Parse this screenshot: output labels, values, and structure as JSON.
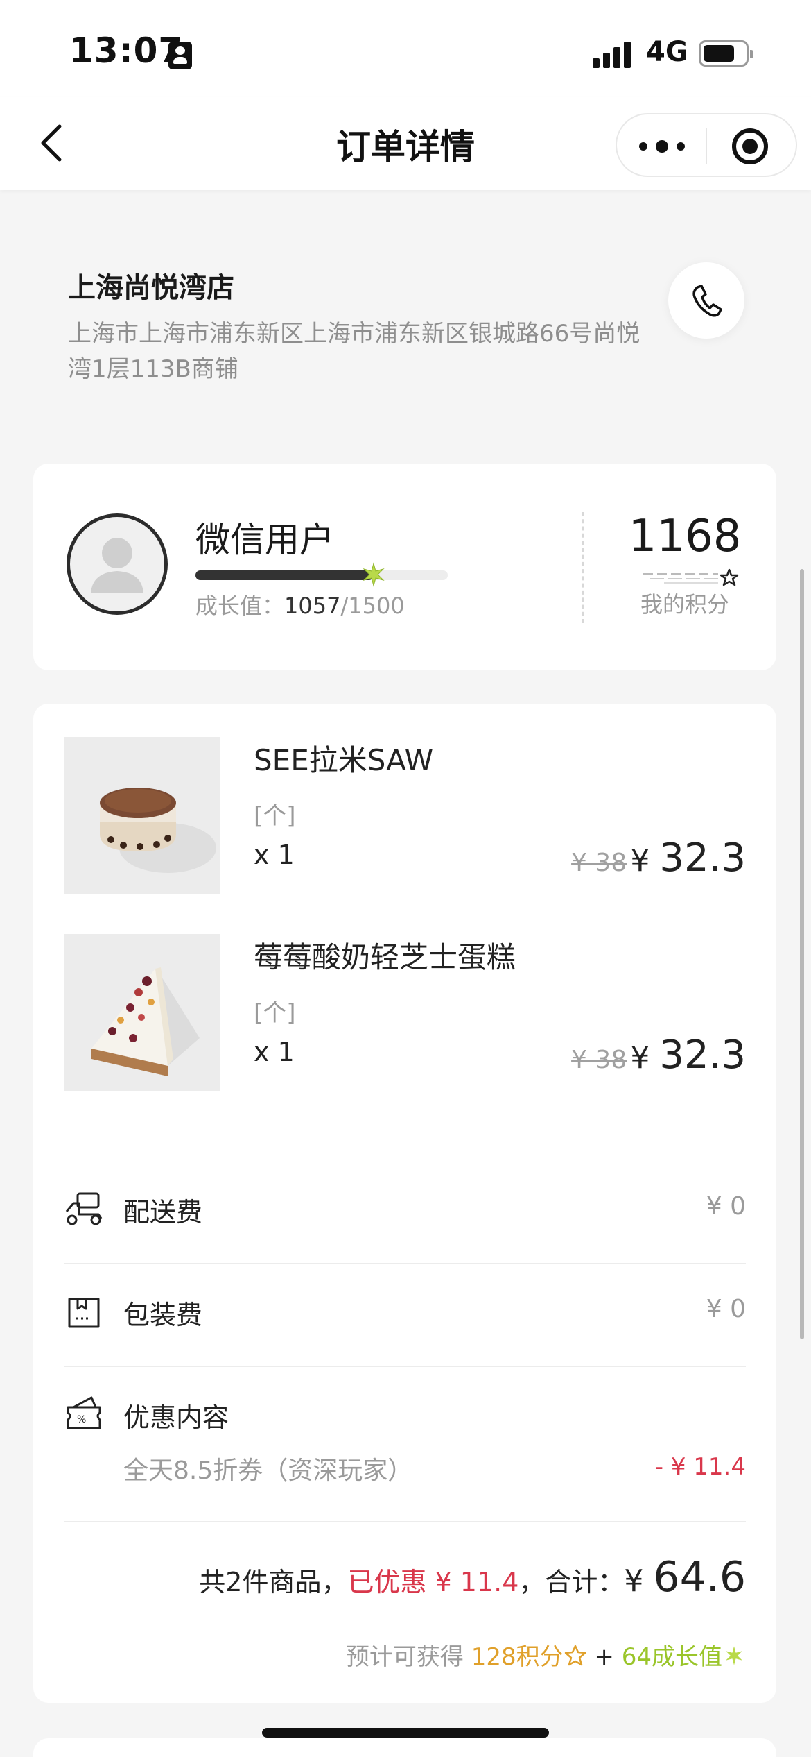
{
  "status_bar": {
    "time": "13:07",
    "network": "4G",
    "icons": [
      "id-card-icon",
      "signal-icon",
      "battery-icon"
    ]
  },
  "nav": {
    "title": "订单详情",
    "icons": [
      "back-chevron-icon",
      "more-dots-icon",
      "target-icon"
    ]
  },
  "store": {
    "name": "上海尚悦湾店",
    "address": "上海市上海市浦东新区上海市浦东新区银城路66号尚悦湾1层113B商铺",
    "phone_icon": "phone-icon"
  },
  "member": {
    "name": "微信用户",
    "growth_label": "成长值：",
    "growth_current": "1057",
    "growth_total": "/1500",
    "growth_fraction": 0.705,
    "points": "1168",
    "points_label": "我的积分"
  },
  "products": [
    {
      "name": "SEE拉米SAW",
      "unit": "[个]",
      "qty": "x 1",
      "price_old": "¥ 38",
      "price_symbol": "¥ ",
      "price_new": "32.3",
      "image": "tiramisu-cup"
    },
    {
      "name": "莓莓酸奶轻芝士蛋糕",
      "unit": "[个]",
      "qty": "x 1",
      "price_old": "¥ 38",
      "price_symbol": "¥ ",
      "price_new": "32.3",
      "image": "cheesecake-slice"
    }
  ],
  "fees": {
    "delivery_label": "配送费",
    "delivery_value": "¥ 0",
    "packaging_label": "包装费",
    "packaging_value": "¥ 0",
    "discount_label": "优惠内容",
    "discount_item": "全天8.5折券（资深玩家）",
    "discount_value": "- ¥ 11.4"
  },
  "summary": {
    "count_text": "共2件商品，",
    "saved_text": "已优惠 ¥ 11.4",
    "total_label": "，合计：",
    "total_symbol": "¥ ",
    "total_value": "64.6",
    "earn_prefix": "预计可获得 ",
    "earn_points": "128积分",
    "earn_plus": " + ",
    "earn_growth": "64成长值"
  },
  "colors": {
    "accent_red": "#d9374b",
    "gold": "#e0a02a",
    "green": "#9ac52a",
    "background": "#f5f5f5"
  }
}
